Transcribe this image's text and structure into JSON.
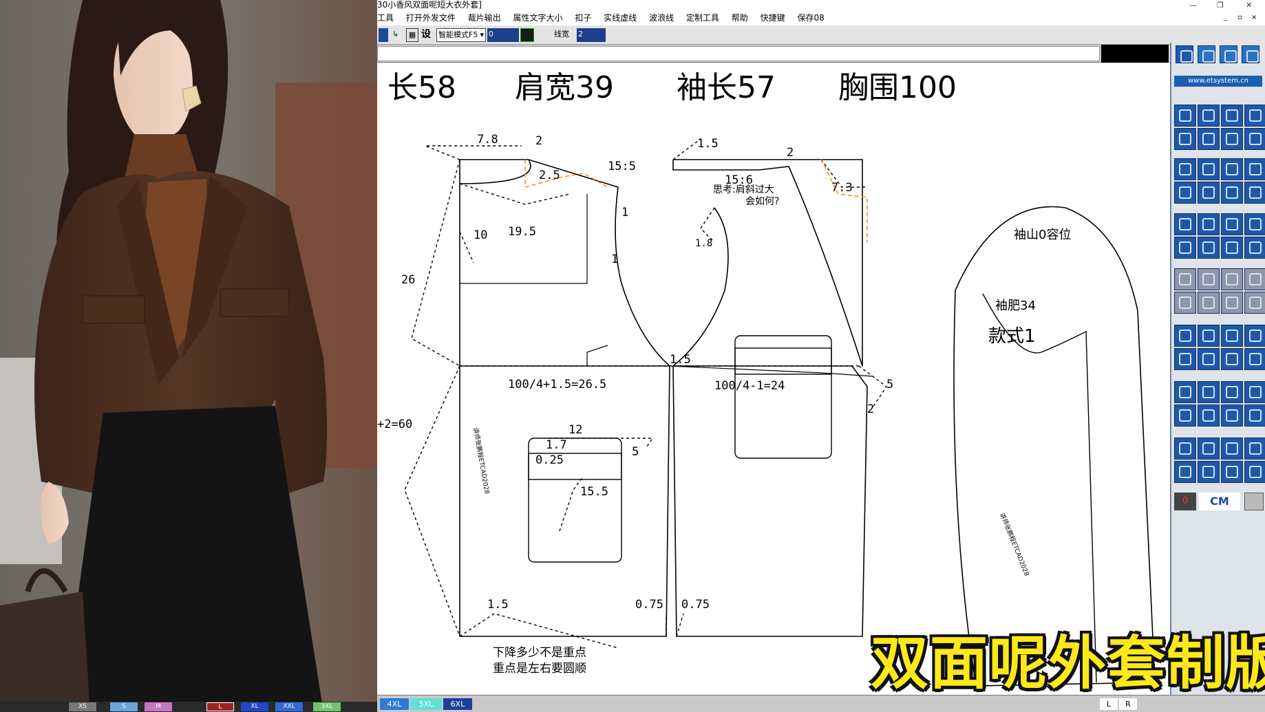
{
  "window": {
    "title": "30小香风双面呢短大衣外套]"
  },
  "menu": [
    "工具",
    "打开外发文件",
    "裁片输出",
    "属性文字大小",
    "扣子",
    "实线虚线",
    "波浪线",
    "定制工具",
    "帮助",
    "快捷键",
    "保存08"
  ],
  "toolbar": {
    "mode_label": "设",
    "mode_select": "智能模式F5",
    "value1": "0",
    "linewidth_label": "线宽",
    "linewidth_value": "2"
  },
  "palette": {
    "url": "www.etsystem.cn",
    "zero_label": "0",
    "unit_label": "CM"
  },
  "measurements": {
    "length": "长58",
    "shoulder": "肩宽39",
    "sleeve": "袖长57",
    "bust": "胸围100"
  },
  "pattern_labels": {
    "d78": "7.8",
    "d2a": "2",
    "d25": "2.5",
    "d155": "15:5",
    "d15a": "1.5",
    "d2b": "2",
    "d156": "15:6",
    "d73": "7.3",
    "d1a": "1",
    "d10": "10",
    "d195": "19.5",
    "d1b": "1",
    "d18": "1.8",
    "d26": "26",
    "note_think": "思考:肩斜过大",
    "note_why": "会如何?",
    "d15b": "1.5",
    "front_width": "100/4+1.5=26.5",
    "back_width": "100/4-1=24",
    "d5a": "5",
    "d2c": "2",
    "length_total": "+2=60",
    "d12": "12",
    "d17": "1.7",
    "d025": "0.25",
    "d5b": "5",
    "d155b": "15.5",
    "d15c": "1.5",
    "d075a": "0.75",
    "d075b": "0.75",
    "watermark": "讲师张鹏程ETCAD2028",
    "note_drop1": "下降多少不是重点",
    "note_drop2": "重点是左右要圆顺",
    "sleeve_cap": "袖山0容位",
    "sleeve_bicep": "袖肥34",
    "style": "款式1"
  },
  "sizes": [
    "4XL",
    "5XL",
    "6XL"
  ],
  "left_sizes": [
    "XS",
    "S",
    "M",
    "L",
    "XL",
    "XXL",
    "3XL"
  ],
  "nav": [
    "L",
    "R"
  ],
  "banner": "双面呢外套制版"
}
